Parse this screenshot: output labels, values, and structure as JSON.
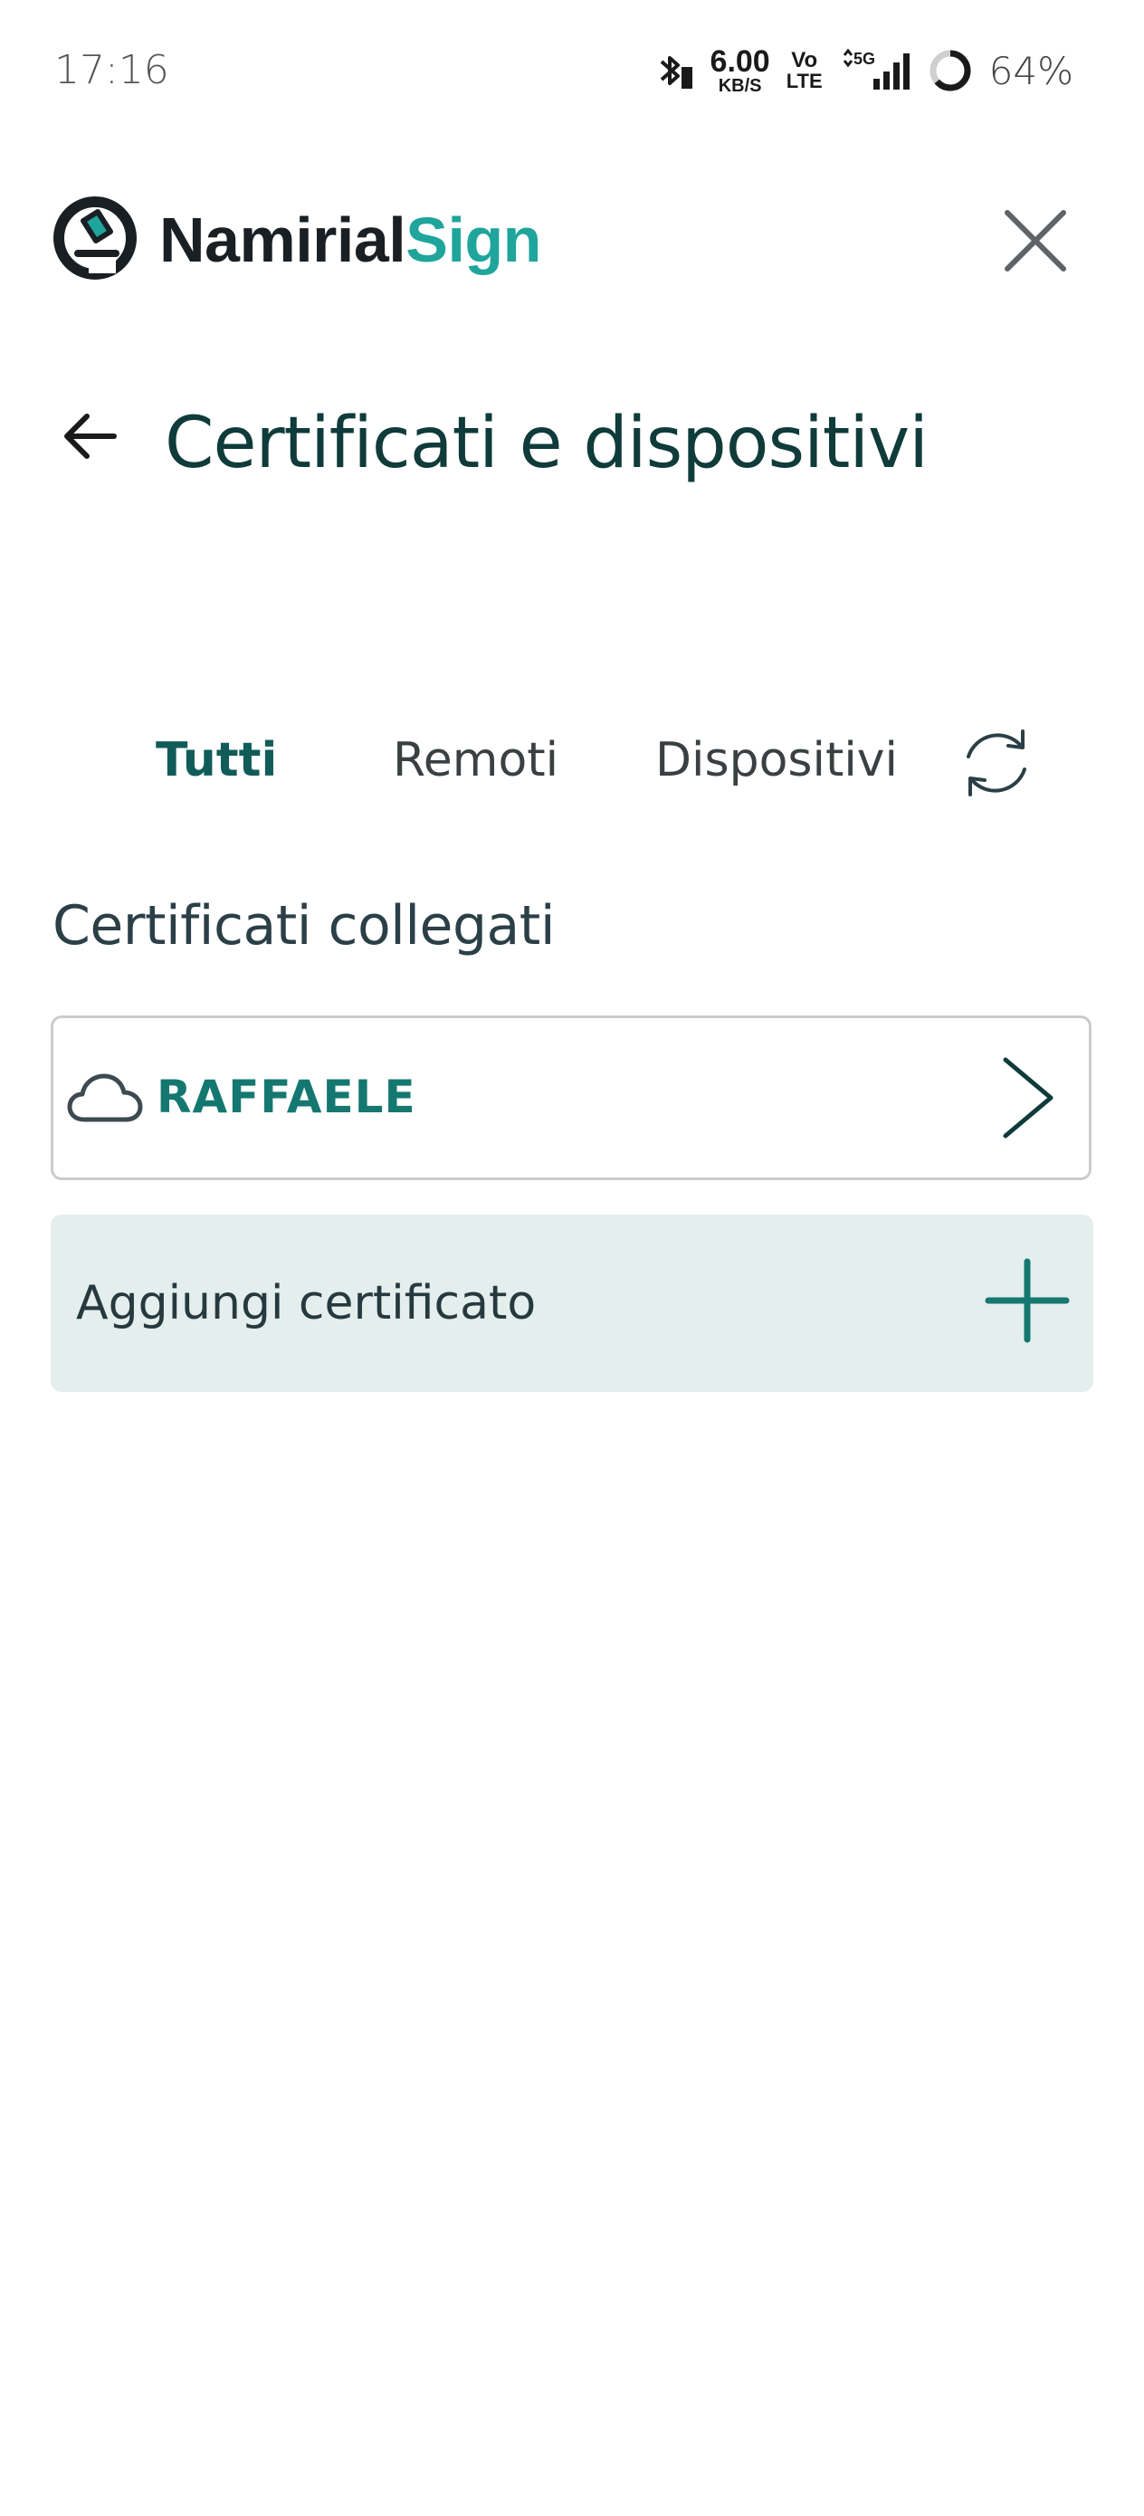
{
  "status_bar": {
    "time": "17:16",
    "network_speed_value": "6.00",
    "network_speed_unit": "KB/S",
    "volte_top": "Vo",
    "volte_bottom": "LTE",
    "network_type": "5G",
    "battery_percent": "64%"
  },
  "header": {
    "brand_part1": "Namirial",
    "brand_part2": "Sign"
  },
  "page": {
    "title": "Certificati e dispositivi"
  },
  "tabs": [
    {
      "label": "Tutti",
      "active": true
    },
    {
      "label": "Remoti",
      "active": false
    },
    {
      "label": "Dispositivi",
      "active": false
    }
  ],
  "section": {
    "title": "Certificati collegati"
  },
  "certificates": [
    {
      "name": "RAFFAELE",
      "type_icon": "cloud-icon"
    }
  ],
  "add_certificate": {
    "label": "Aggiungi certificato"
  },
  "colors": {
    "brand_dark": "#1a1f24",
    "brand_teal": "#1fa59b",
    "title": "#0f3b3a",
    "accent": "#157870",
    "add_bg": "#e4eeed"
  }
}
